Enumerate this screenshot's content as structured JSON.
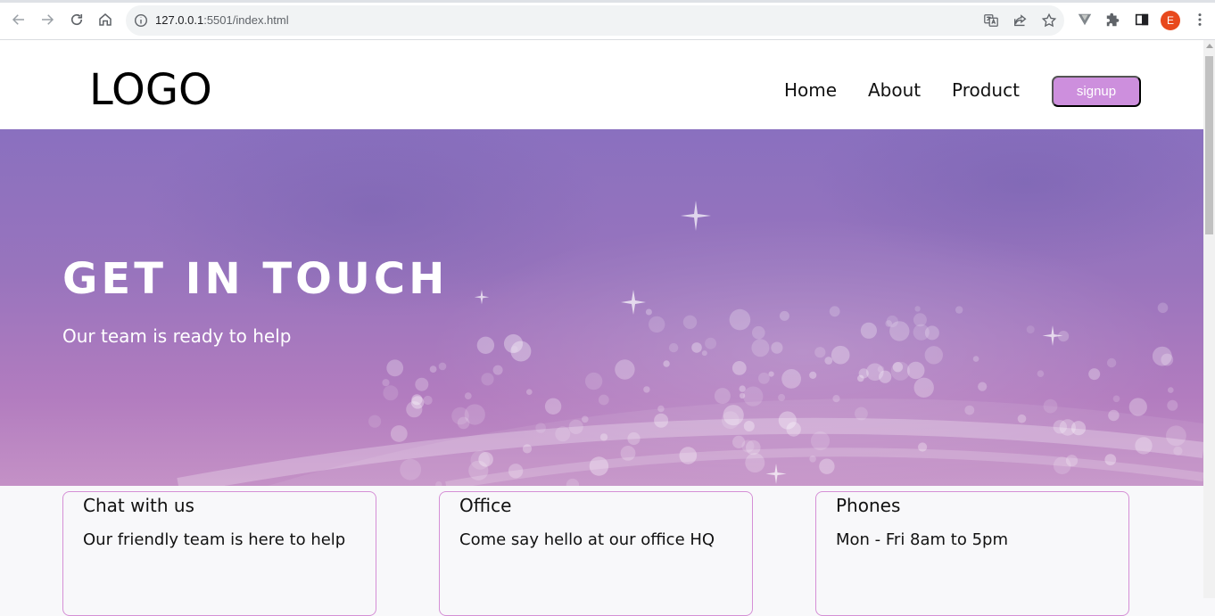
{
  "browser": {
    "url_host": "127.0.0.1",
    "url_path": ":5501/index.html",
    "avatar_initial": "E"
  },
  "header": {
    "logo": "LOGO",
    "nav": [
      "Home",
      "About",
      "Product"
    ],
    "signup_label": "signup"
  },
  "hero": {
    "title": "GET IN TOUCH",
    "subtitle": "Our team is ready to help"
  },
  "cards": [
    {
      "title": "Chat with us",
      "text": "Our friendly team is here to help"
    },
    {
      "title": "Office",
      "text": "Come say hello at our office HQ"
    },
    {
      "title": "Phones",
      "text": "Mon - Fri 8am to 5pm"
    }
  ],
  "colors": {
    "accent": "#cd8fdd",
    "hero_top": "#8a70bf",
    "hero_bottom": "#c491c6",
    "card_border": "#d58fd6"
  }
}
